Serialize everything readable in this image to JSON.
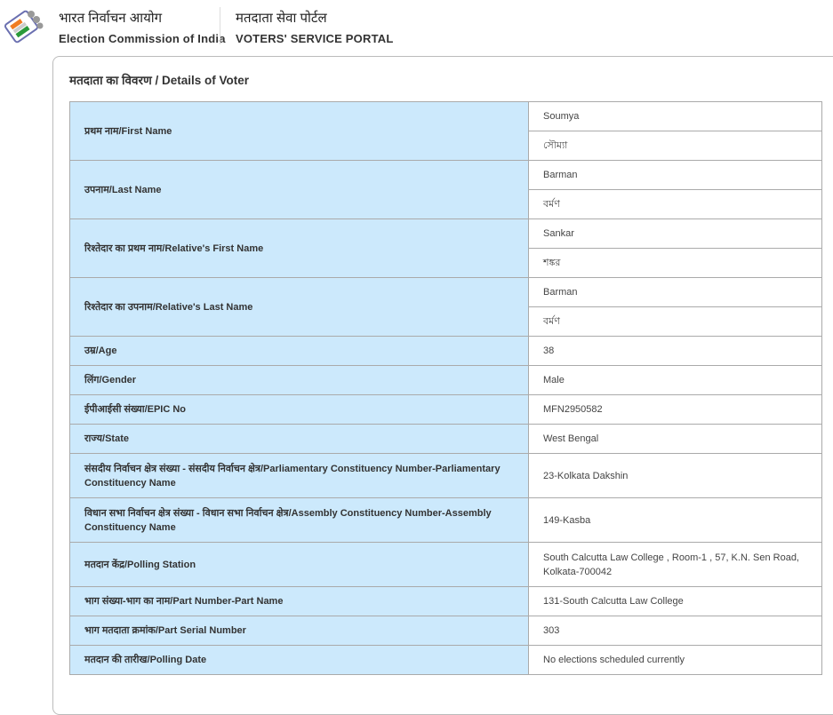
{
  "header": {
    "org_hindi": "भारत निर्वाचन आयोग",
    "org_english": "Election Commission of India",
    "portal_hindi": "मतदाता सेवा पोर्टल",
    "portal_english": "VOTERS' SERVICE PORTAL"
  },
  "section_title": "मतदाता का विवरण / Details of Voter",
  "rows": [
    {
      "label": "प्रथम नाम/First Name",
      "values": [
        "Soumya",
        "সৌম্যা"
      ]
    },
    {
      "label": "उपनाम/Last Name",
      "values": [
        "Barman",
        "বর্মণ"
      ]
    },
    {
      "label": "रिश्तेदार का प्रथम नाम/Relative's First Name",
      "values": [
        "Sankar",
        "শঙ্কর"
      ]
    },
    {
      "label": "रिश्तेदार का उपनाम/Relative's Last Name",
      "values": [
        "Barman",
        "বর্মণ"
      ]
    },
    {
      "label": "उम्र/Age",
      "value": "38"
    },
    {
      "label": "लिंग/Gender",
      "value": "Male"
    },
    {
      "label": "ईपीआईसी संख्या/EPIC No",
      "value": "MFN2950582"
    },
    {
      "label": "राज्य/State",
      "value": "West Bengal"
    },
    {
      "label": "संसदीय निर्वाचन क्षेत्र संख्या - संसदीय निर्वाचन क्षेत्र/Parliamentary Constituency Number-Parliamentary Constituency Name",
      "value": "23-Kolkata Dakshin"
    },
    {
      "label": "विधान सभा निर्वाचन क्षेत्र संख्या - विधान सभा निर्वाचन क्षेत्र/Assembly Constituency Number-Assembly Constituency Name",
      "value": "149-Kasba"
    },
    {
      "label": "मतदान केंद्र/Polling Station",
      "value": "South Calcutta Law College , Room-1 , 57, K.N. Sen Road, Kolkata-700042"
    },
    {
      "label": "भाग संख्या-भाग का नाम/Part Number-Part Name",
      "value": "131-South Calcutta Law College"
    },
    {
      "label": "भाग मतदाता क्रमांक/Part Serial Number",
      "value": "303"
    },
    {
      "label": "मतदान की तारीख/Polling Date",
      "value": "No elections scheduled currently"
    }
  ]
}
